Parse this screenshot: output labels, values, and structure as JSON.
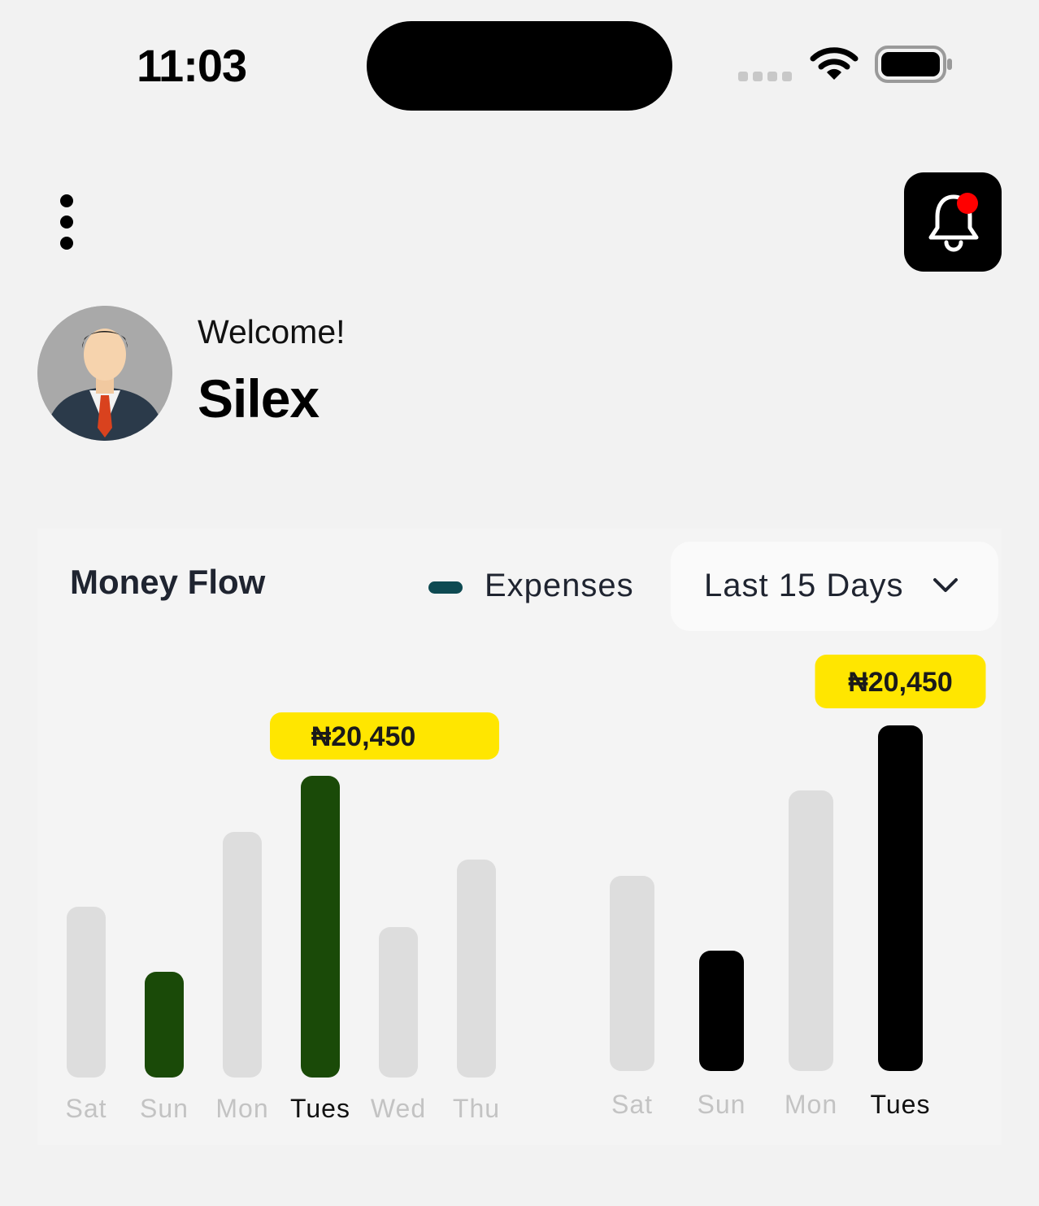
{
  "status_bar": {
    "time": "11:03",
    "signal_icon": "cellular-signal-icon",
    "wifi_icon": "wifi-icon",
    "battery_icon": "battery-icon"
  },
  "header": {
    "menu_icon": "more-vertical-icon",
    "notification_icon": "bell-icon",
    "notification_badge_color": "#ff0000"
  },
  "profile": {
    "greeting": "Welcome!",
    "name": "Silex"
  },
  "money_flow": {
    "title": "Money Flow",
    "legend_label": "Expenses",
    "legend_color": "#0e4a52",
    "range_select": {
      "value": "Last 15 Days",
      "icon": "chevron-down-icon"
    }
  },
  "chart_data": [
    {
      "type": "bar",
      "categories": [
        "Sat",
        "Sun",
        "Mon",
        "Tues",
        "Wed",
        "Thu"
      ],
      "values": [
        210,
        130,
        302,
        371,
        185,
        268
      ],
      "highlighted": [
        "Sun",
        "Tues"
      ],
      "active_category": "Tues",
      "highlight_color": "#1a4a08",
      "base_color": "#dddddd",
      "tooltip": {
        "category": "Tues",
        "label": "₦20,450"
      }
    },
    {
      "type": "bar",
      "categories": [
        "Sat",
        "Sun",
        "Mon",
        "Tues"
      ],
      "values": [
        240,
        148,
        345,
        425
      ],
      "highlighted": [
        "Sun",
        "Tues"
      ],
      "active_category": "Tues",
      "highlight_color": "#000000",
      "base_color": "#dddddd",
      "tooltip": {
        "category": "Tues",
        "label": "₦20,450"
      }
    }
  ]
}
